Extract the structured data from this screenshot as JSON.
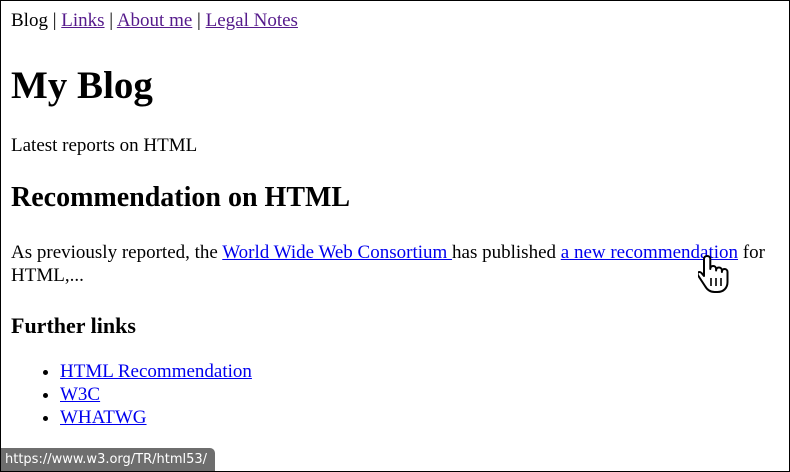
{
  "nav": {
    "current": "Blog",
    "separator": "|",
    "links": [
      "Links",
      "About me",
      "Legal Notes"
    ]
  },
  "page": {
    "title": "My Blog",
    "lead": "Latest reports on HTML",
    "article": {
      "title": "Recommendation on HTML",
      "text_before": "As previously reported, the ",
      "link1": "World Wide Web Consortium ",
      "text_middle": "has published ",
      "link2": "a new recommendation",
      "text_after": " for HTML,..."
    },
    "further": {
      "title": "Further links",
      "items": [
        "HTML Recommendation",
        "W3C",
        "WHATWG"
      ]
    }
  },
  "status_bar": {
    "url": "https://www.w3.org/TR/html53/"
  },
  "colors": {
    "link": "#0000ee",
    "visited": "#551a8b",
    "status_bg": "#6e6e6e"
  },
  "cursor": "hand-pointer-icon"
}
